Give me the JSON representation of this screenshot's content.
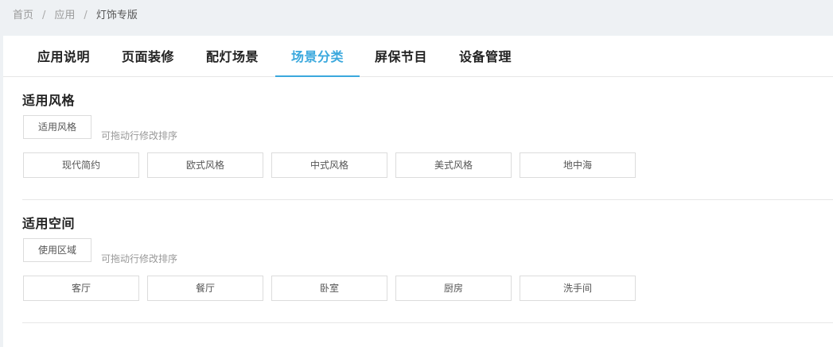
{
  "breadcrumb": {
    "items": [
      "首页",
      "应用",
      "灯饰专版"
    ],
    "separator": "/"
  },
  "tabs": [
    {
      "label": "应用说明"
    },
    {
      "label": "页面装修"
    },
    {
      "label": "配灯场景"
    },
    {
      "label": "场景分类",
      "active": true
    },
    {
      "label": "屏保节目"
    },
    {
      "label": "设备管理"
    }
  ],
  "sections": [
    {
      "title": "适用风格",
      "label_button": "适用风格",
      "hint": "可拖动行修改排序",
      "chips": [
        "现代简约",
        "欧式风格",
        "中式风格",
        "美式风格",
        "地中海"
      ]
    },
    {
      "title": "适用空间",
      "label_button": "使用区域",
      "hint": "可拖动行修改排序",
      "chips": [
        "客厅",
        "餐厅",
        "卧室",
        "厨房",
        "洗手间"
      ]
    }
  ],
  "colors": {
    "accent": "#3aa8dd",
    "background": "#eef1f4",
    "panel": "#ffffff",
    "border": "#dcdcdc",
    "muted_text": "#999999"
  }
}
